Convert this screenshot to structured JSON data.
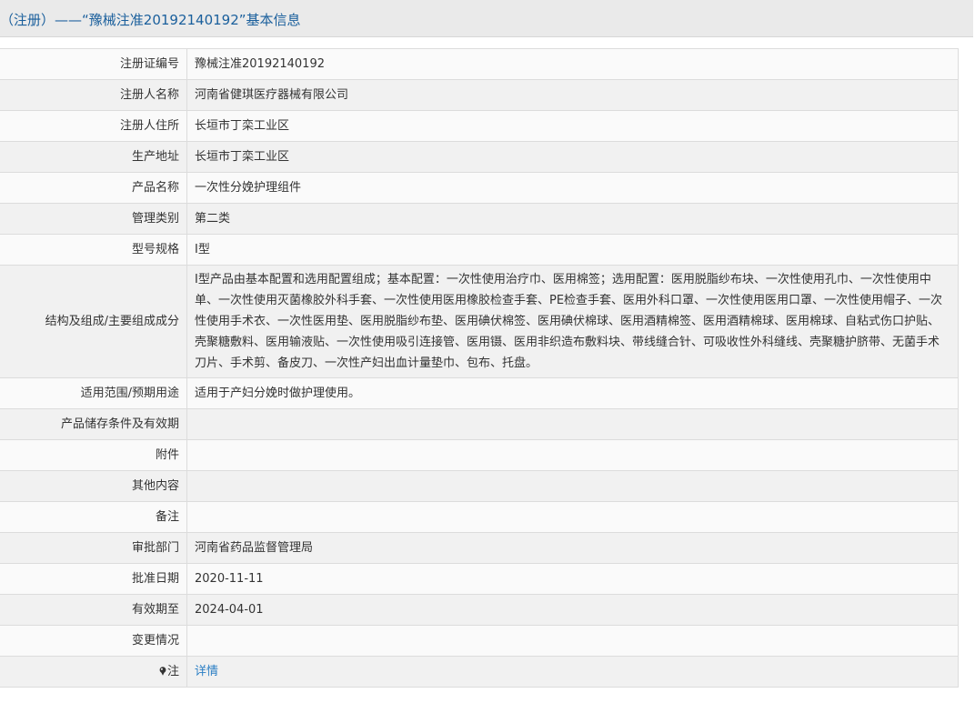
{
  "header": {
    "title": "（注册）——“豫械注准20192140192”基本信息"
  },
  "rows": [
    {
      "label": "注册证编号",
      "value": "豫械注准20192140192"
    },
    {
      "label": "注册人名称",
      "value": "河南省健琪医疗器械有限公司"
    },
    {
      "label": "注册人住所",
      "value": "长垣市丁栾工业区"
    },
    {
      "label": "生产地址",
      "value": "长垣市丁栾工业区"
    },
    {
      "label": "产品名称",
      "value": "一次性分娩护理组件"
    },
    {
      "label": "管理类别",
      "value": "第二类"
    },
    {
      "label": "型号规格",
      "value": "I型"
    },
    {
      "label": "结构及组成/主要组成成分",
      "value": "I型产品由基本配置和选用配置组成；基本配置：一次性使用治疗巾、医用棉签；选用配置：医用脱脂纱布块、一次性使用孔巾、一次性使用中单、一次性使用灭菌橡胶外科手套、一次性使用医用橡胶检查手套、PE检查手套、医用外科口罩、一次性使用医用口罩、一次性使用帽子、一次性使用手术衣、一次性医用垫、医用脱脂纱布垫、医用碘伏棉签、医用碘伏棉球、医用酒精棉签、医用酒精棉球、医用棉球、自粘式伤口护贴、壳聚糖敷料、医用输液贴、一次性使用吸引连接管、医用镊、医用非织造布敷料块、带线缝合针、可吸收性外科缝线、壳聚糖护脐带、无菌手术刀片、手术剪、备皮刀、一次性产妇出血计量垫巾、包布、托盘。"
    },
    {
      "label": "适用范围/预期用途",
      "value": "适用于产妇分娩时做护理使用。"
    },
    {
      "label": "产品储存条件及有效期",
      "value": ""
    },
    {
      "label": "附件",
      "value": ""
    },
    {
      "label": "其他内容",
      "value": ""
    },
    {
      "label": "备注",
      "value": ""
    },
    {
      "label": "审批部门",
      "value": "河南省药品监督管理局"
    },
    {
      "label": "批准日期",
      "value": "2020-11-11"
    },
    {
      "label": "有效期至",
      "value": "2024-04-01"
    },
    {
      "label": "变更情况",
      "value": ""
    }
  ],
  "note_row": {
    "label": "注",
    "icon": "pin-icon",
    "link": "详情"
  }
}
